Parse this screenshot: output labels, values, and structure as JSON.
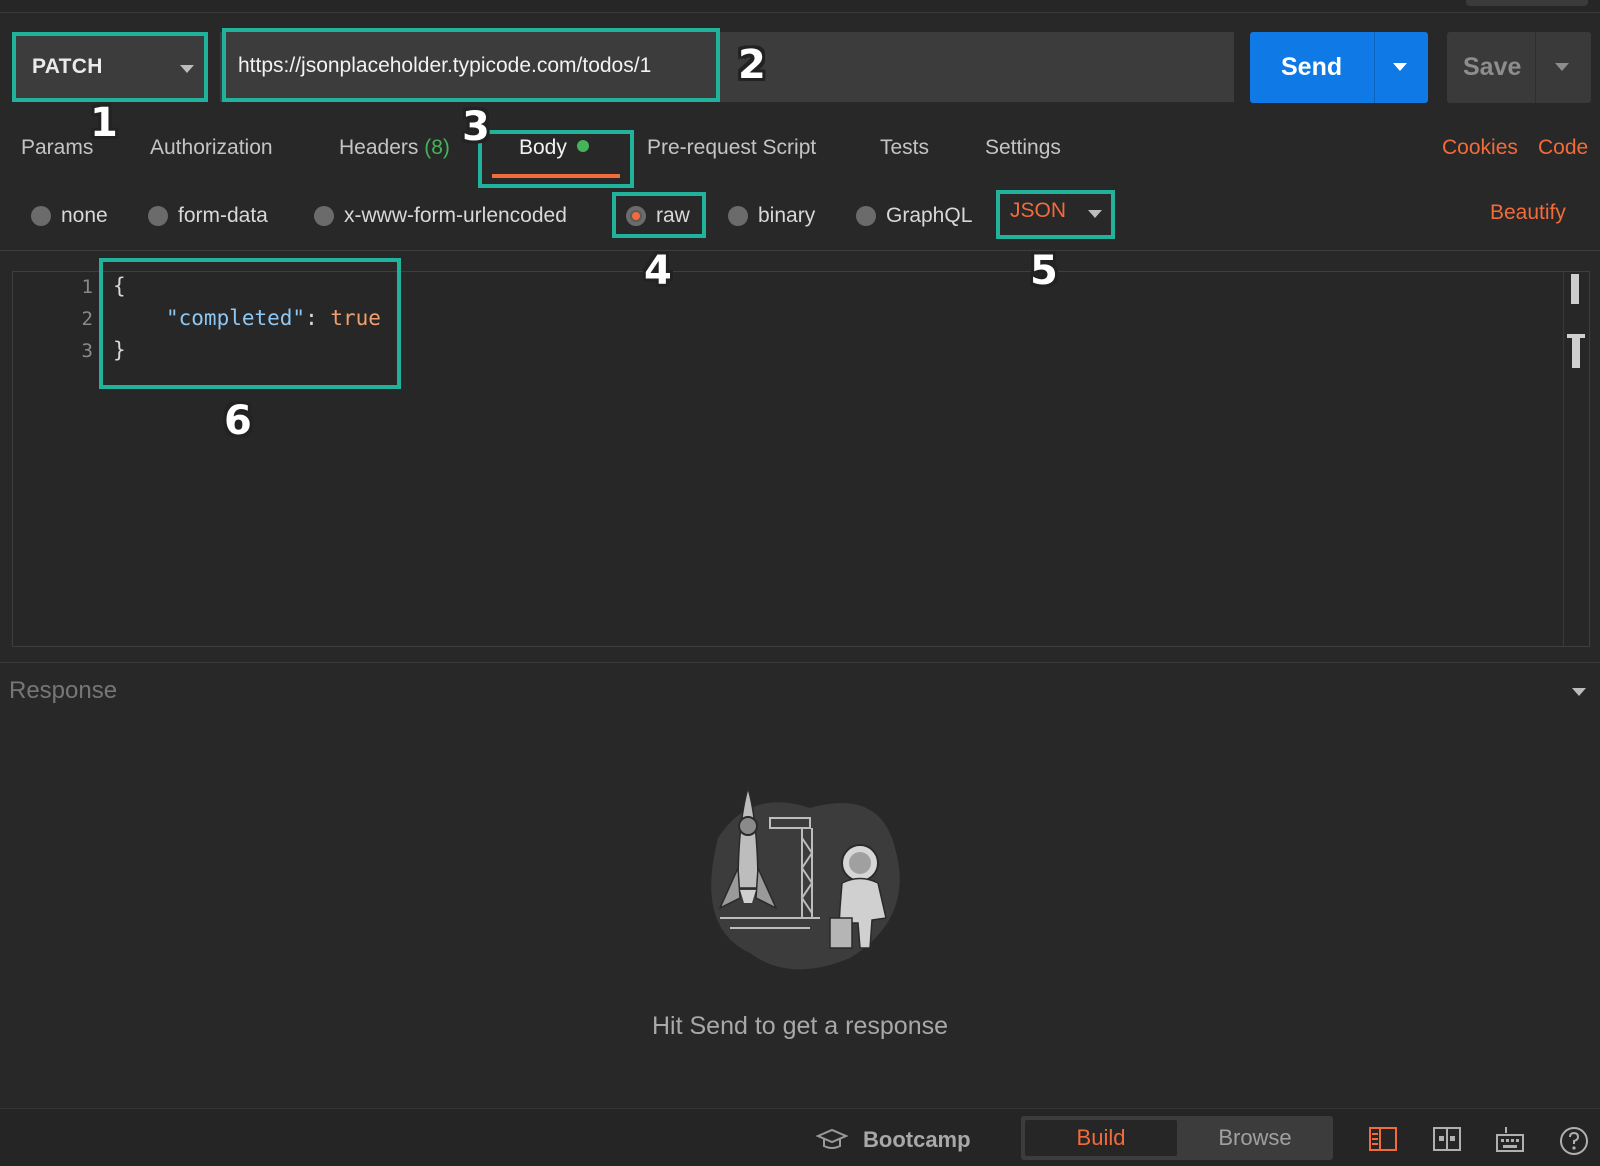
{
  "request": {
    "method": "PATCH",
    "url": "https://jsonplaceholder.typicode.com/todos/1",
    "send_label": "Send",
    "save_label": "Save"
  },
  "tabs": {
    "params": "Params",
    "authorization": "Authorization",
    "headers": "Headers",
    "headers_count": "(8)",
    "body": "Body",
    "pre_request": "Pre-request Script",
    "tests": "Tests",
    "settings": "Settings",
    "cookies": "Cookies",
    "code": "Code"
  },
  "body_types": {
    "none": "none",
    "form_data": "form-data",
    "urlencoded": "x-www-form-urlencoded",
    "raw": "raw",
    "binary": "binary",
    "graphql": "GraphQL",
    "selected": "raw",
    "format": "JSON",
    "beautify": "Beautify"
  },
  "editor": {
    "line_numbers": [
      "1",
      "2",
      "3"
    ],
    "open_brace": "{",
    "key": "\"completed\"",
    "colon": ": ",
    "value": "true",
    "close_brace": "}"
  },
  "response": {
    "title": "Response",
    "empty_message": "Hit Send to get a response"
  },
  "statusbar": {
    "bootcamp": "Bootcamp",
    "build": "Build",
    "browse": "Browse",
    "active_mode": "Build"
  },
  "annotations": [
    "1",
    "2",
    "3",
    "4",
    "5",
    "6"
  ],
  "colors": {
    "accent_orange": "#f26b3a",
    "send_blue": "#0f7ae5",
    "annotation_teal": "#20b29a",
    "active_green": "#45b35a"
  }
}
